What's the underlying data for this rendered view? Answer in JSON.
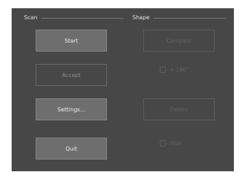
{
  "scan": {
    "label": "Scan",
    "start_label": "Start",
    "accept_label": "Accept",
    "settings_label": "Settings...",
    "quit_label": "Quit"
  },
  "shape": {
    "label": "Shape",
    "compare_label": "Compare",
    "plus180_label": "+ 180°",
    "delete_label": "Delete",
    "hide_label": "Hide"
  }
}
